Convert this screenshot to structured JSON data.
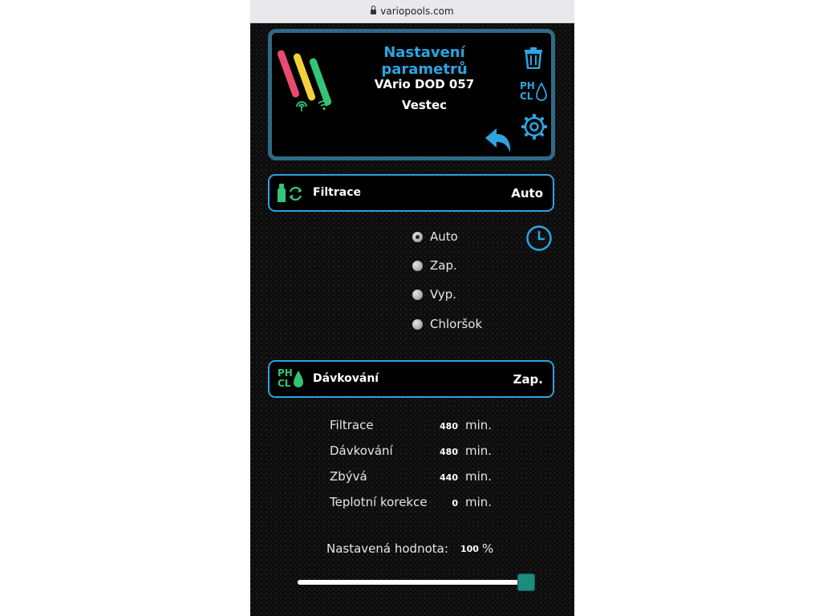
{
  "browser": {
    "url": "variopools.com"
  },
  "header": {
    "title": "Nastavení parametrů",
    "device": "VArio DOD 057",
    "location": "Vestec",
    "ph_label": "PH",
    "cl_label": "CL",
    "logo_colors": [
      "#e94a6f",
      "#f2d23a",
      "#35c477"
    ],
    "accent": "#2ea4e0",
    "signal_color": "#35c477"
  },
  "filtrace": {
    "label": "Filtrace",
    "value": "Auto",
    "icon_color": "#35c477",
    "options": [
      {
        "label": "Auto",
        "selected": true
      },
      {
        "label": "Zap.",
        "selected": false
      },
      {
        "label": "Vyp.",
        "selected": false
      },
      {
        "label": "Chloršok",
        "selected": false
      }
    ]
  },
  "davkovani": {
    "label": "Dávkování",
    "value": "Zap.",
    "ph_label": "PH",
    "cl_label": "CL",
    "icon_color": "#35c477"
  },
  "stats": [
    {
      "label": "Filtrace",
      "value": "480",
      "unit": "min."
    },
    {
      "label": "Dávkování",
      "value": "480",
      "unit": "min."
    },
    {
      "label": "Zbývá",
      "value": "440",
      "unit": "min."
    },
    {
      "label": "Teplotní korekce",
      "value": "0",
      "unit": "min."
    }
  ],
  "setpoint": {
    "label": "Nastavená hodnota:",
    "value": "100",
    "unit": "%",
    "slider_fraction": 1.0,
    "thumb_color": "#1b8c7f"
  }
}
